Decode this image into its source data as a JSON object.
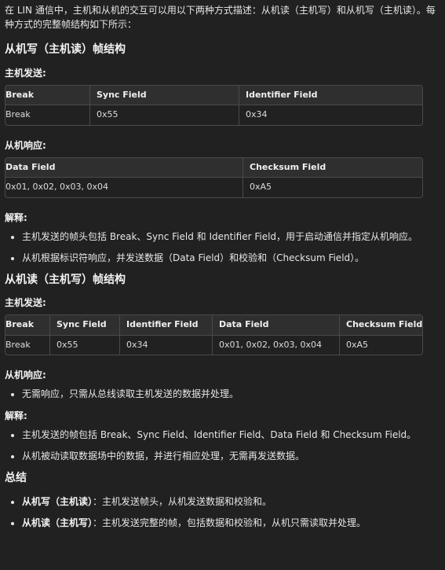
{
  "intro": "在 LIN 通信中，主机和从机的交互可以用以下两种方式描述：从机读（主机写）和从机写（主机读）。每种方式的完整帧结构如下所示：",
  "section1": {
    "title": "从机写（主机读）帧结构",
    "master_label": "主机发送:",
    "master_table": {
      "headers": [
        "Break",
        "Sync Field",
        "Identifier Field"
      ],
      "rows": [
        [
          "Break",
          "0x55",
          "0x34"
        ]
      ]
    },
    "slave_label": "从机响应:",
    "slave_table": {
      "headers": [
        "Data Field",
        "Checksum Field"
      ],
      "rows": [
        [
          "0x01, 0x02, 0x03, 0x04",
          "0xA5"
        ]
      ]
    },
    "explain_label": "解释:",
    "bullets": [
      "主机发送的帧头包括 Break、Sync Field 和 Identifier Field，用于启动通信并指定从机响应。",
      "从机根据标识符响应，并发送数据（Data Field）和校验和（Checksum Field）。"
    ]
  },
  "section2": {
    "title": "从机读（主机写）帧结构",
    "master_label": "主机发送:",
    "master_table": {
      "headers": [
        "Break",
        "Sync Field",
        "Identifier Field",
        "Data Field",
        "Checksum Field"
      ],
      "rows": [
        [
          "Break",
          "0x55",
          "0x34",
          "0x01, 0x02, 0x03, 0x04",
          "0xA5"
        ]
      ]
    },
    "slave_label": "从机响应:",
    "slave_bullets": [
      "无需响应，只需从总线读取主机发送的数据并处理。"
    ],
    "explain_label": "解释:",
    "bullets": [
      "主机发送的帧包括 Break、Sync Field、Identifier Field、Data Field 和 Checksum Field。",
      "从机被动读取数据场中的数据，并进行相应处理，无需再发送数据。"
    ]
  },
  "summary": {
    "title": "总结",
    "items": [
      {
        "bold": "从机写（主机读）",
        "text": "：主机发送帧头，从机发送数据和校验和。"
      },
      {
        "bold": "从机读（主机写）",
        "text": "：主机发送完整的帧，包括数据和校验和，从机只需读取并处理。"
      }
    ]
  }
}
